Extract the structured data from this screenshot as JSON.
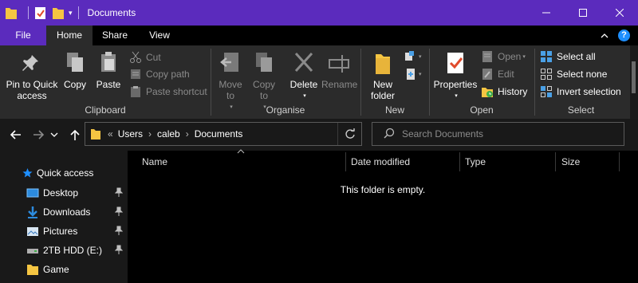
{
  "window": {
    "title": "Documents"
  },
  "tabs": {
    "file": "File",
    "home": "Home",
    "share": "Share",
    "view": "View"
  },
  "ribbon": {
    "clipboard": {
      "label": "Clipboard",
      "pin": "Pin to Quick access",
      "copy": "Copy",
      "paste": "Paste",
      "cut": "Cut",
      "copy_path": "Copy path",
      "paste_shortcut": "Paste shortcut"
    },
    "organise": {
      "label": "Organise",
      "move_to": "Move to",
      "copy_to": "Copy to",
      "delete": "Delete",
      "rename": "Rename"
    },
    "new": {
      "label": "New",
      "new_folder": "New folder"
    },
    "open": {
      "label": "Open",
      "properties": "Properties",
      "open": "Open",
      "edit": "Edit",
      "history": "History"
    },
    "select": {
      "label": "Select",
      "select_all": "Select all",
      "select_none": "Select none",
      "invert": "Invert selection"
    }
  },
  "address": {
    "overflow": "«",
    "crumbs": [
      "Users",
      "caleb",
      "Documents"
    ]
  },
  "search": {
    "placeholder": "Search Documents"
  },
  "navpane": {
    "quick_access": "Quick access",
    "items": [
      "Desktop",
      "Downloads",
      "Pictures",
      "2TB HDD (E:)",
      "Game"
    ]
  },
  "columns": {
    "name": "Name",
    "date": "Date modified",
    "type": "Type",
    "size": "Size"
  },
  "content": {
    "empty_message": "This folder is empty."
  },
  "colors": {
    "accent": "#5b2bbd",
    "ribbon_bg": "#2b2b2b",
    "content_bg": "#000000",
    "folder": "#f5c542",
    "link_blue": "#1e8fff"
  }
}
